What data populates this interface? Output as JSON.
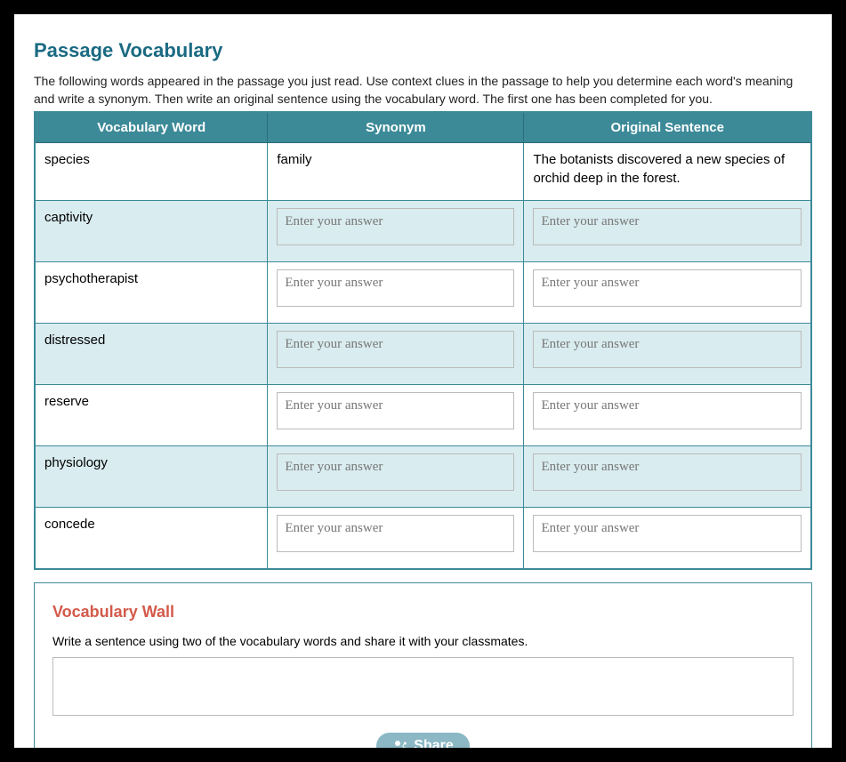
{
  "title": "Passage Vocabulary",
  "instructions": "The following words appeared in the passage you just read. Use context clues in the passage to help you determine each word's meaning and write a synonym. Then write an original sentence using the vocabulary word. The first one has been completed for you.",
  "headers": {
    "word": "Vocabulary Word",
    "synonym": "Synonym",
    "sentence": "Original Sentence"
  },
  "input_placeholder": "Enter your answer",
  "rows": [
    {
      "word": "species",
      "synonym_text": "family",
      "sentence_text": "The botanists discovered a new species of orchid deep in the forest.",
      "editable": false
    },
    {
      "word": "captivity",
      "editable": true
    },
    {
      "word": "psychotherapist",
      "editable": true
    },
    {
      "word": "distressed",
      "editable": true
    },
    {
      "word": "reserve",
      "editable": true
    },
    {
      "word": "physiology",
      "editable": true
    },
    {
      "word": "concede",
      "editable": true
    }
  ],
  "wall": {
    "title": "Vocabulary Wall",
    "instructions": "Write a sentence using two of the vocabulary words and share it with your classmates.",
    "share_label": "Share"
  }
}
